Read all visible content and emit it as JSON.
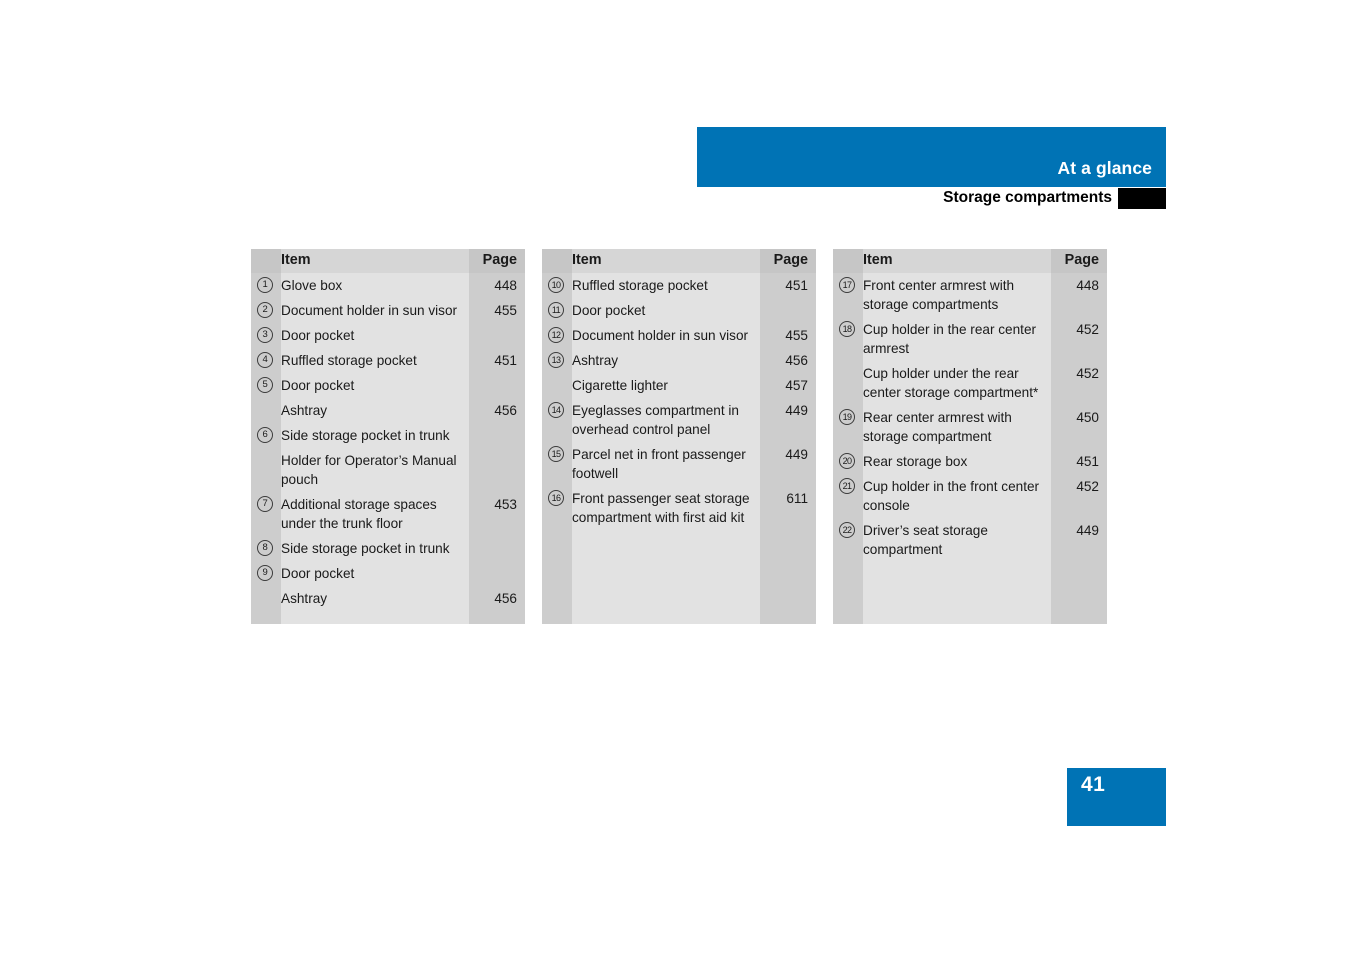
{
  "header": {
    "chapter": "At a glance",
    "section": "Storage compartments"
  },
  "footer": {
    "page_number": "41"
  },
  "colors": {
    "accent_blue": "#0073b5",
    "tab_black": "#000000",
    "header_row_grey": "#d6d6d6",
    "item_cell_grey": "#e2e2e2",
    "page_cell_grey": "#cdcdcd"
  },
  "tables": [
    {
      "id": "table-1",
      "columns": {
        "item": "Item",
        "page": "Page"
      },
      "rows": [
        {
          "num": "1",
          "item": "Glove box",
          "page": "448"
        },
        {
          "num": "2",
          "item": "Document holder in sun visor",
          "page": "455"
        },
        {
          "num": "3",
          "item": "Door pocket",
          "page": ""
        },
        {
          "num": "4",
          "item": "Ruffled storage pocket",
          "page": "451"
        },
        {
          "num": "5",
          "item": "Door pocket",
          "page": ""
        },
        {
          "num": "",
          "item": "Ashtray",
          "page": "456"
        },
        {
          "num": "6",
          "item": "Side storage pocket in trunk",
          "page": ""
        },
        {
          "num": "",
          "item": "Holder for Operator’s Manual pouch",
          "page": ""
        },
        {
          "num": "7",
          "item": "Additional storage spaces under the trunk floor",
          "page": "453"
        },
        {
          "num": "8",
          "item": "Side storage pocket in trunk",
          "page": ""
        },
        {
          "num": "9",
          "item": "Door pocket",
          "page": ""
        },
        {
          "num": "",
          "item": "Ashtray",
          "page": "456"
        }
      ]
    },
    {
      "id": "table-2",
      "columns": {
        "item": "Item",
        "page": "Page"
      },
      "rows": [
        {
          "num": "10",
          "item": "Ruffled storage pocket",
          "page": "451"
        },
        {
          "num": "11",
          "item": "Door pocket",
          "page": ""
        },
        {
          "num": "12",
          "item": "Document holder in sun visor",
          "page": "455"
        },
        {
          "num": "13",
          "item": "Ashtray",
          "page": "456"
        },
        {
          "num": "",
          "item": "Cigarette lighter",
          "page": "457"
        },
        {
          "num": "14",
          "item": "Eyeglasses compartment in overhead control panel",
          "page": "449"
        },
        {
          "num": "15",
          "item": "Parcel net in front passenger footwell",
          "page": "449"
        },
        {
          "num": "16",
          "item": "Front passenger seat storage compartment with first aid kit",
          "page": "611"
        }
      ]
    },
    {
      "id": "table-3",
      "columns": {
        "item": "Item",
        "page": "Page"
      },
      "rows": [
        {
          "num": "17",
          "item": "Front center armrest with storage compartments",
          "page": "448"
        },
        {
          "num": "18",
          "item": "Cup holder in the rear center armrest",
          "page": "452"
        },
        {
          "num": "",
          "item": "Cup holder under the rear center storage compartment*",
          "page": "452"
        },
        {
          "num": "19",
          "item": "Rear center armrest with storage compartment",
          "page": "450"
        },
        {
          "num": "20",
          "item": "Rear storage box",
          "page": "451"
        },
        {
          "num": "21",
          "item": "Cup holder in the front center console",
          "page": "452"
        },
        {
          "num": "22",
          "item": "Driver’s seat storage compartment",
          "page": "449"
        }
      ]
    }
  ]
}
